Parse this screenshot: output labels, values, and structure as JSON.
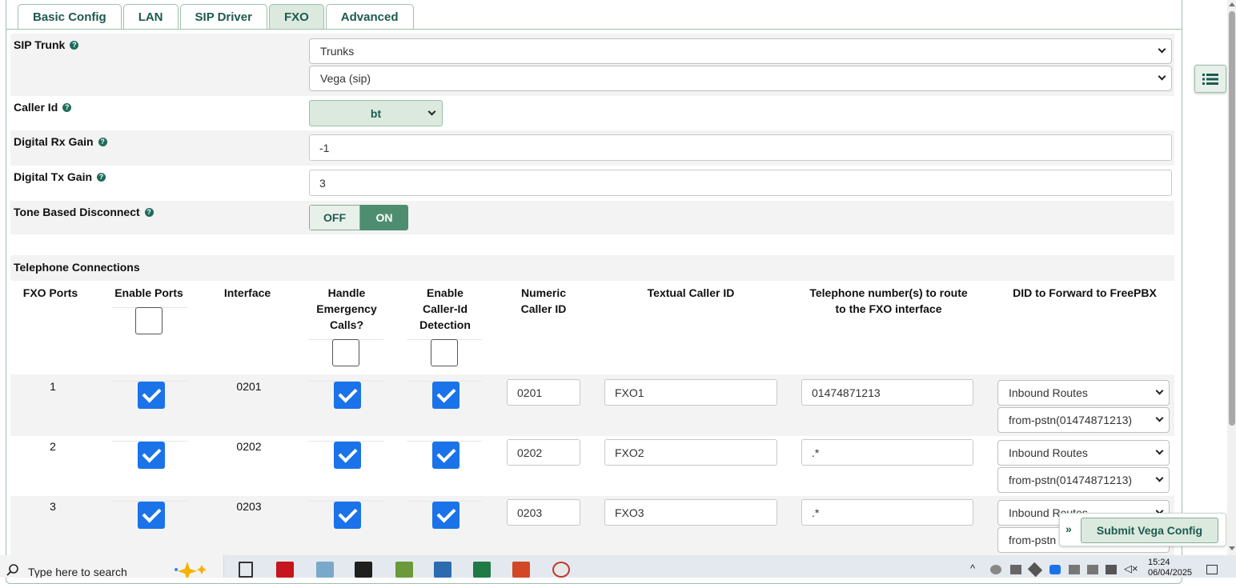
{
  "tabs": [
    "Basic Config",
    "LAN",
    "SIP Driver",
    "FXO",
    "Advanced"
  ],
  "active_tab": "FXO",
  "sip_trunk": {
    "label": "SIP Trunk",
    "select1": "Trunks",
    "select2": "Vega (sip)"
  },
  "caller_id": {
    "label": "Caller Id",
    "value": "bt"
  },
  "rx_gain": {
    "label": "Digital Rx Gain",
    "value": "-1"
  },
  "tx_gain": {
    "label": "Digital Tx Gain",
    "value": "3"
  },
  "tone_disconnect": {
    "label": "Tone Based Disconnect",
    "off": "OFF",
    "on": "ON",
    "state": "ON"
  },
  "telephone": {
    "title": "Telephone Connections",
    "headers": {
      "fxo_ports": "FXO Ports",
      "enable_ports": "Enable Ports",
      "interface": "Interface",
      "handle_emergency_1": "Handle",
      "handle_emergency_2": "Emergency",
      "handle_emergency_3": "Calls?",
      "callerid_detect_1": "Enable",
      "callerid_detect_2": "Caller-Id",
      "callerid_detect_3": "Detection",
      "numeric_1": "Numeric",
      "numeric_2": "Caller ID",
      "textual": "Textual Caller ID",
      "route_1": "Telephone number(s) to route",
      "route_2": "to the FXO interface",
      "did": "DID to Forward to FreePBX"
    },
    "rows": [
      {
        "port": "1",
        "interface": "0201",
        "numeric": "0201",
        "textual": "FXO1",
        "route": "01474871213",
        "did1": "Inbound Routes",
        "did2": "from-pstn(01474871213)"
      },
      {
        "port": "2",
        "interface": "0202",
        "numeric": "0202",
        "textual": "FXO2",
        "route": ".*",
        "did1": "Inbound Routes",
        "did2": "from-pstn(01474871213)"
      },
      {
        "port": "3",
        "interface": "0203",
        "numeric": "0203",
        "textual": "FXO3",
        "route": ".*",
        "did1": "Inbound Routes",
        "did2": "from-pstn"
      }
    ]
  },
  "submit_label": "Submit Vega Config",
  "taskbar": {
    "search_placeholder": "Type here to search",
    "time": "15:24",
    "date": "06/04/2025"
  },
  "colors": {
    "accent": "#1d5a4f",
    "checkbox": "#1a73e8",
    "toggle_on": "#4e8e70"
  }
}
